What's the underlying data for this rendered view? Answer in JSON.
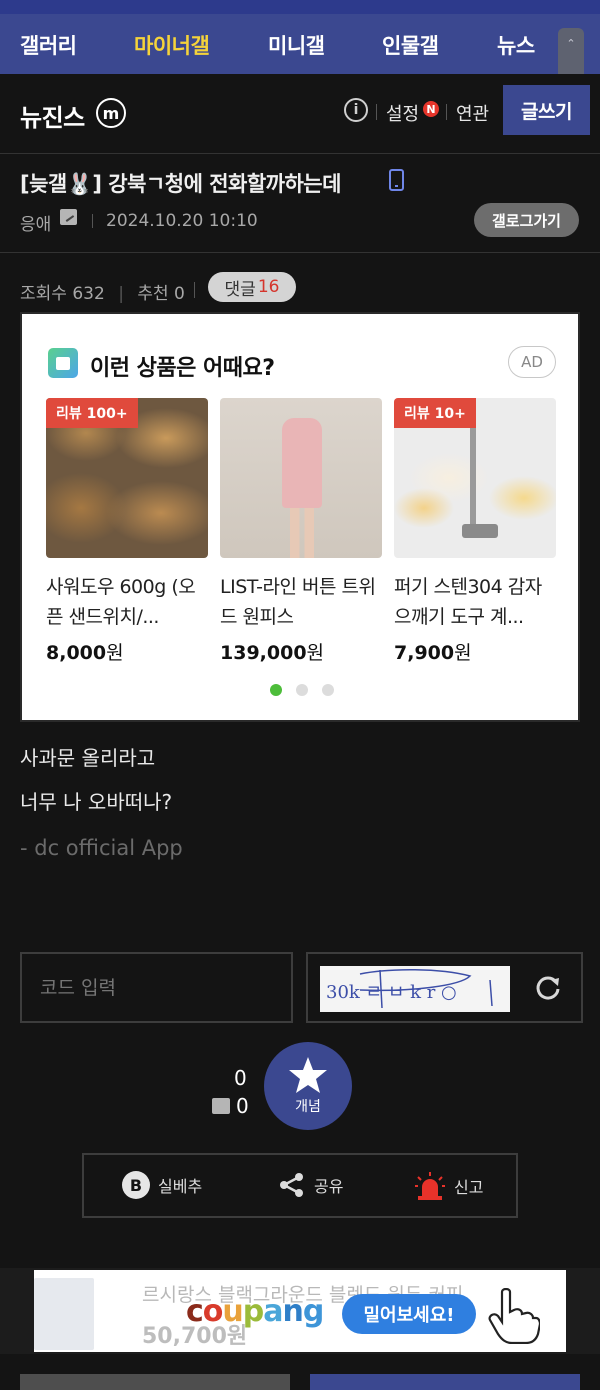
{
  "gnb": {
    "items": [
      {
        "label": "갤러리",
        "active": false
      },
      {
        "label": "마이너갤",
        "active": true
      },
      {
        "label": "미니갤",
        "active": false
      },
      {
        "label": "인물갤",
        "active": false
      },
      {
        "label": "뉴스",
        "active": false
      }
    ],
    "accent_color": "#f5d33a",
    "bar_color": "#3b4890"
  },
  "gallery": {
    "name": "뉴진스",
    "minor_badge": "m",
    "info_icon": "info-icon",
    "settings_label": "설정",
    "new_badge": "N",
    "related_label": "연관",
    "write_label": "글쓰기"
  },
  "post": {
    "title": "[늦갤🐰] 강북ㄱ청에 전화할까하는데",
    "writer": "응애",
    "date": "2024.10.20 10:10",
    "gallog_label": "갤로그가기",
    "views_label": "조회수 632",
    "recommend_label": "추천 0",
    "comment_label": "댓글",
    "comment_count": "16",
    "body_lines": [
      "사과문 올리라고",
      "너무 나 오바떠나?"
    ],
    "signature": "- dc official App"
  },
  "ad": {
    "heading": "이런 상품은 어때요?",
    "badge": "AD",
    "products": [
      {
        "tag": "리뷰 100+",
        "name": "사워도우 600g (오픈 샌드위치/...",
        "price": "8,000",
        "currency": "원"
      },
      {
        "tag": "",
        "name": "LIST-라인 버튼 트위드 원피스",
        "price": "139,000",
        "currency": "원"
      },
      {
        "tag": "리뷰 10+",
        "name": "퍼기 스텐304 감자으깨기 도구 계...",
        "price": "7,900",
        "currency": "원"
      }
    ],
    "page_dots": 3,
    "active_dot": 0
  },
  "captcha": {
    "placeholder": "코드 입력",
    "image_text": "30k ㄹ ㅂ k r ○"
  },
  "vote": {
    "recommend_count": "0",
    "fix_recommend_count": "0",
    "button_label": "개념"
  },
  "actions": {
    "silbe_label": "실베추",
    "share_label": "공유",
    "report_label": "신고"
  },
  "banner": {
    "faded_text": "르시랑스 블랙그라운드 블렌드 원두 커피",
    "faded_price": "50,700원",
    "brand": "coupang",
    "cta": "밀어보세요!"
  }
}
